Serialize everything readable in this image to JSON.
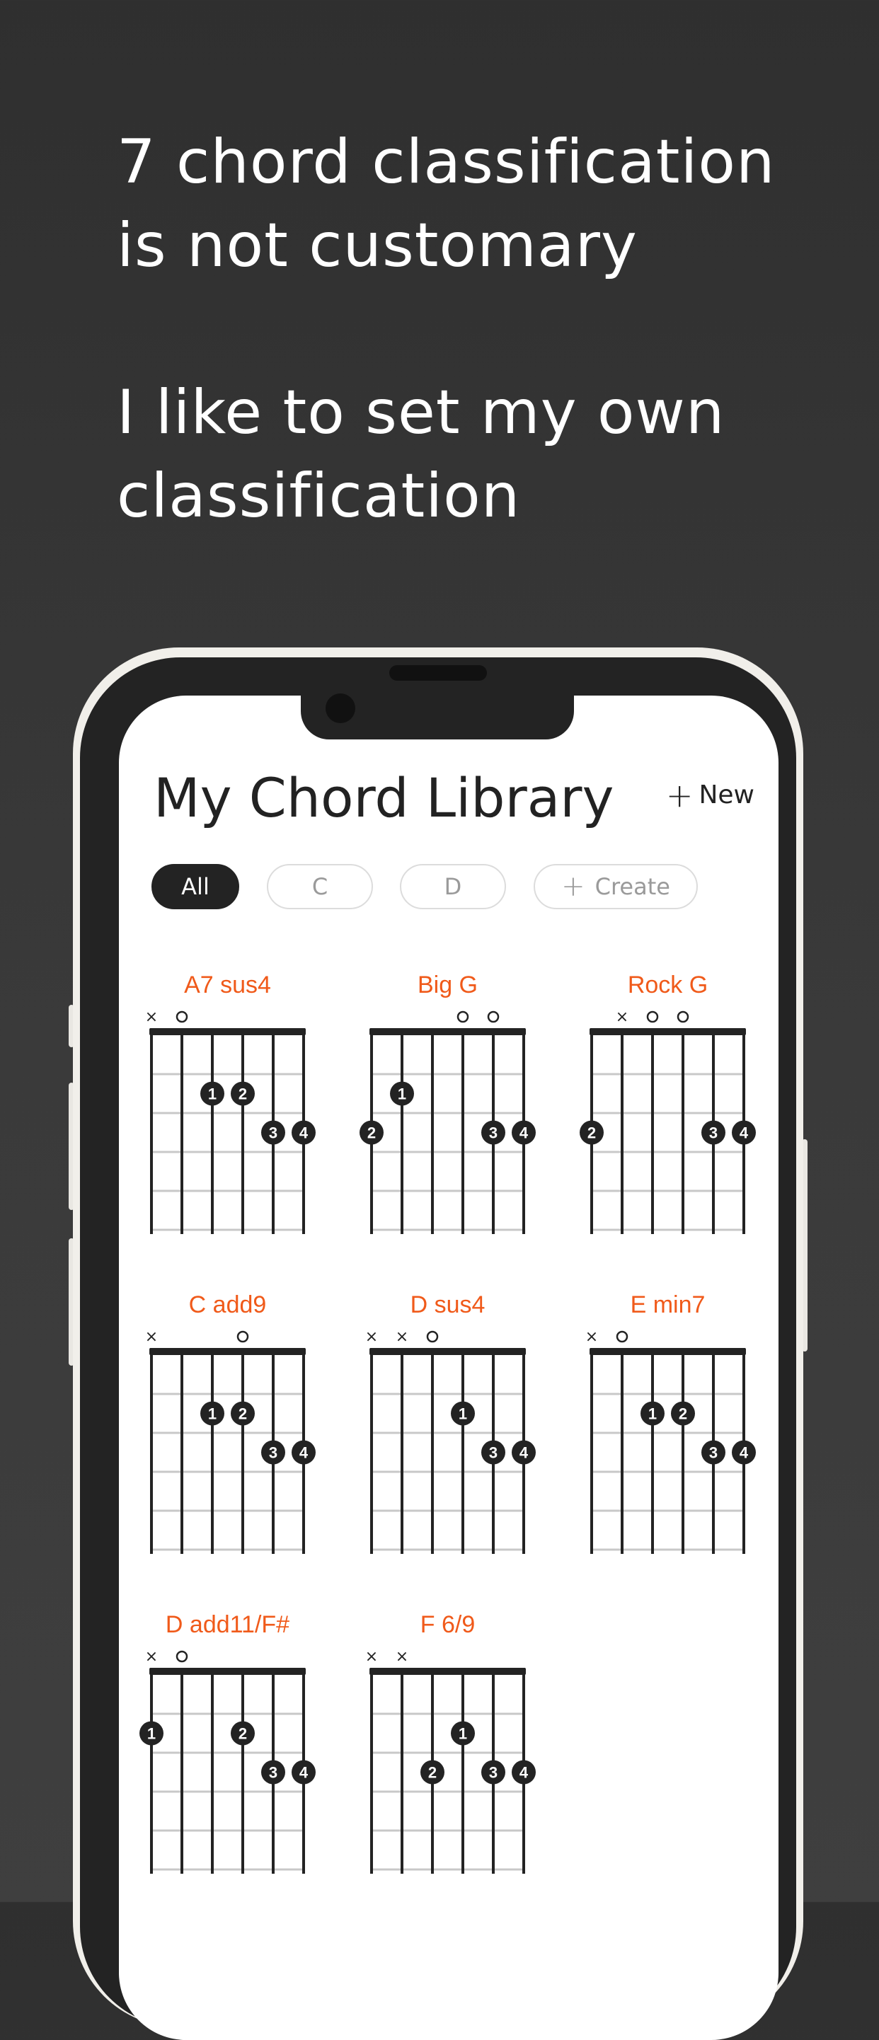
{
  "headline": {
    "line1": "7 chord classification",
    "line2": "is not customary",
    "line3": "I like to set my own",
    "line4": "classification"
  },
  "app": {
    "title": "My Chord Library",
    "new_label": "New"
  },
  "tabs": [
    {
      "label": "All",
      "active": true
    },
    {
      "label": "C",
      "active": false
    },
    {
      "label": "D",
      "active": false
    },
    {
      "label": "Create",
      "active": false
    }
  ],
  "colors": {
    "chord_name": "#f05a1a",
    "dark": "#232323",
    "grid": "#c8c8c8"
  },
  "chords": [
    {
      "name": "A7 sus4",
      "markers": [
        "x",
        "o",
        "",
        "",
        "",
        ""
      ],
      "dots": [
        {
          "s": 3,
          "f": 2,
          "n": 1
        },
        {
          "s": 4,
          "f": 2,
          "n": 2
        },
        {
          "s": 5,
          "f": 3,
          "n": 3
        },
        {
          "s": 6,
          "f": 3,
          "n": 4
        }
      ]
    },
    {
      "name": "Big G",
      "markers": [
        "",
        "",
        "",
        "o",
        "o",
        ""
      ],
      "dots": [
        {
          "s": 2,
          "f": 2,
          "n": 1
        },
        {
          "s": 1,
          "f": 3,
          "n": 2
        },
        {
          "s": 5,
          "f": 3,
          "n": 3
        },
        {
          "s": 6,
          "f": 3,
          "n": 4
        }
      ]
    },
    {
      "name": "Rock G",
      "markers": [
        "",
        "x",
        "o",
        "o",
        "",
        ""
      ],
      "dots": [
        {
          "s": 1,
          "f": 3,
          "n": 2
        },
        {
          "s": 5,
          "f": 3,
          "n": 3
        },
        {
          "s": 6,
          "f": 3,
          "n": 4
        }
      ]
    },
    {
      "name": "C add9",
      "markers": [
        "x",
        "",
        "",
        "o",
        "",
        ""
      ],
      "dots": [
        {
          "s": 3,
          "f": 2,
          "n": 1
        },
        {
          "s": 4,
          "f": 2,
          "n": 2
        },
        {
          "s": 5,
          "f": 3,
          "n": 3
        },
        {
          "s": 6,
          "f": 3,
          "n": 4
        }
      ]
    },
    {
      "name": "D sus4",
      "markers": [
        "x",
        "x",
        "o",
        "",
        "",
        ""
      ],
      "dots": [
        {
          "s": 4,
          "f": 2,
          "n": 1
        },
        {
          "s": 5,
          "f": 3,
          "n": 3
        },
        {
          "s": 6,
          "f": 3,
          "n": 4
        }
      ]
    },
    {
      "name": "E min7",
      "markers": [
        "x",
        "o",
        "",
        "",
        "",
        ""
      ],
      "dots": [
        {
          "s": 3,
          "f": 2,
          "n": 1
        },
        {
          "s": 4,
          "f": 2,
          "n": 2
        },
        {
          "s": 5,
          "f": 3,
          "n": 3
        },
        {
          "s": 6,
          "f": 3,
          "n": 4
        }
      ]
    },
    {
      "name": "D add11/F#",
      "markers": [
        "x",
        "o",
        "",
        "",
        "",
        ""
      ],
      "dots": [
        {
          "s": 1,
          "f": 2,
          "n": 1
        },
        {
          "s": 4,
          "f": 2,
          "n": 2
        },
        {
          "s": 5,
          "f": 3,
          "n": 3
        },
        {
          "s": 6,
          "f": 3,
          "n": 4
        }
      ]
    },
    {
      "name": "F 6/9",
      "markers": [
        "x",
        "x",
        "",
        "",
        "",
        ""
      ],
      "dots": [
        {
          "s": 4,
          "f": 2,
          "n": 1
        },
        {
          "s": 3,
          "f": 3,
          "n": 2
        },
        {
          "s": 5,
          "f": 3,
          "n": 3
        },
        {
          "s": 6,
          "f": 3,
          "n": 4
        }
      ]
    }
  ]
}
